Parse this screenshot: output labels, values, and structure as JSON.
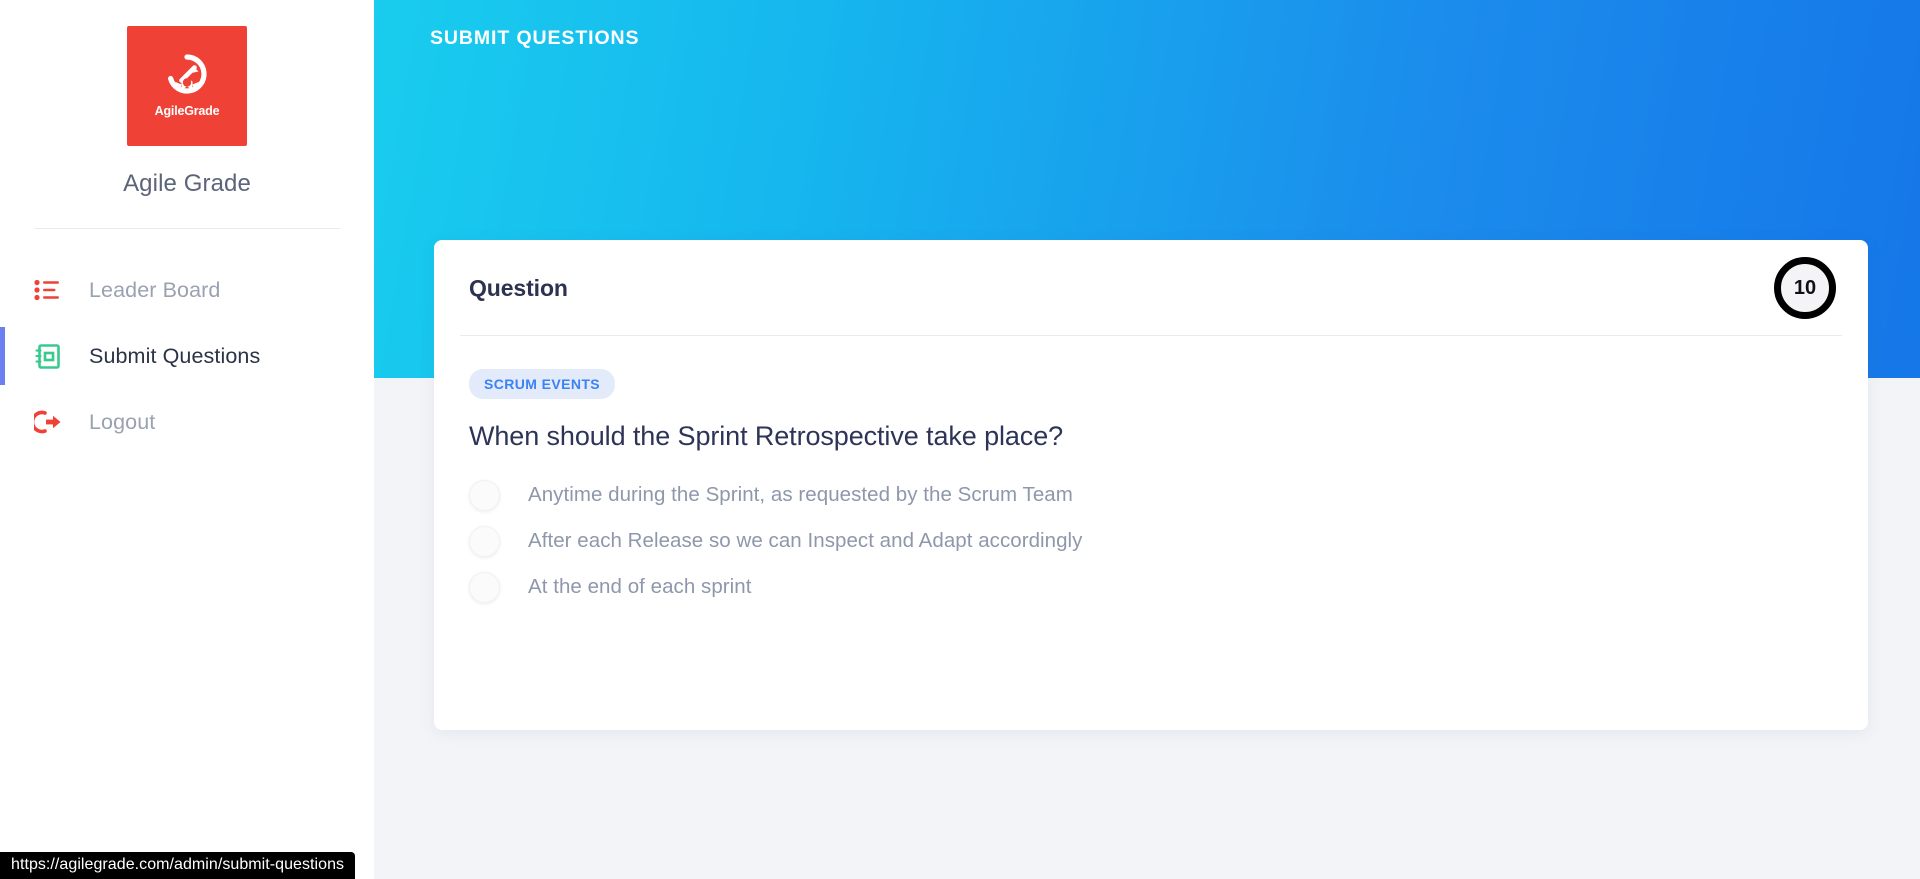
{
  "sidebar": {
    "logo": {
      "icon": "agilegrade-medal-icon",
      "wordmark": "AgileGrade",
      "background_color": "#ef4136"
    },
    "brand_name": "Agile Grade",
    "items": [
      {
        "label": "Leader Board",
        "icon": "list-icon",
        "icon_color": "#ef4136",
        "active": false
      },
      {
        "label": "Submit Questions",
        "icon": "notebook-icon",
        "icon_color": "#38c98d",
        "active": true
      },
      {
        "label": "Logout",
        "icon": "logout-icon",
        "icon_color": "#ef4136",
        "active": false
      }
    ],
    "active_indicator_color": "#6b7ff0"
  },
  "header": {
    "title": "SUBMIT QUESTIONS",
    "gradient_from": "#19cdee",
    "gradient_to": "#1577e8"
  },
  "card": {
    "title": "Question",
    "counter": "10",
    "tag": "SCRUM EVENTS",
    "tag_color": "#3b82f6",
    "tag_background": "#e3ebfa",
    "question": "When should the Sprint Retrospective take place?",
    "options": [
      {
        "label": "Anytime during the Sprint, as requested by the Scrum Team",
        "selected": false
      },
      {
        "label": "After each Release so we can Inspect and Adapt accordingly",
        "selected": false
      },
      {
        "label": "At the end of each sprint",
        "selected": false
      }
    ]
  },
  "status_bar": {
    "url": "https://agilegrade.com/admin/submit-questions"
  }
}
